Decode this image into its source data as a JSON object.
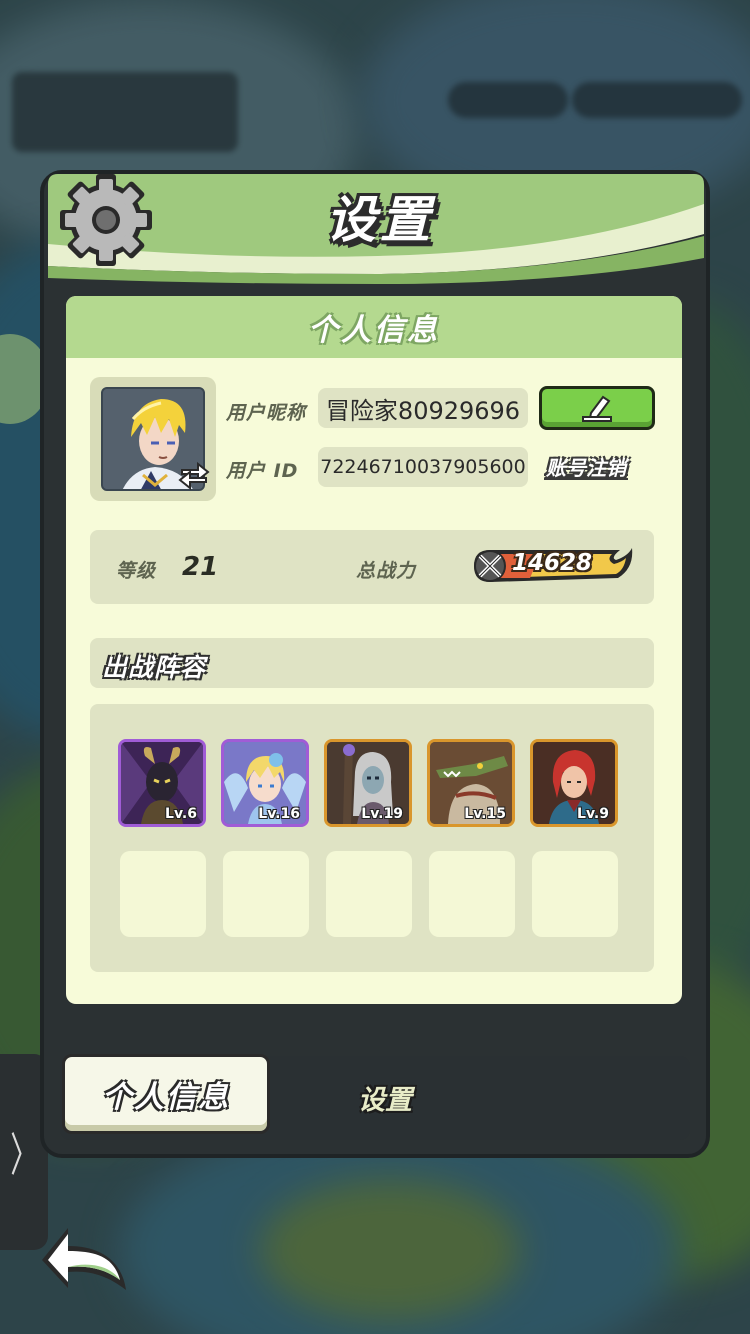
{
  "dialog": {
    "title": "设置",
    "section_title": "个人信息"
  },
  "profile": {
    "nickname_label": "用户昵称",
    "nickname": "冒险家80929696",
    "id_label": "用户 ID",
    "user_id": "72246710037905600",
    "cancel_account": "账号注销",
    "level_label": "等级",
    "level": "21",
    "power_label": "总战力",
    "power": "14628"
  },
  "lineup": {
    "title": "出战阵容",
    "heroes": [
      {
        "level": "Lv.6",
        "rarity_color": "#a05cd6"
      },
      {
        "level": "Lv.16",
        "rarity_color": "#a05cd6"
      },
      {
        "level": "Lv.19",
        "rarity_color": "#d9962c"
      },
      {
        "level": "Lv.15",
        "rarity_color": "#d9962c"
      },
      {
        "level": "Lv.9",
        "rarity_color": "#d9962c"
      }
    ],
    "empty_slots": 5
  },
  "tabs": [
    {
      "label": "个人信息",
      "active": true
    },
    {
      "label": "设置",
      "active": false
    }
  ],
  "side_tab": {
    "glyph": "〉"
  },
  "icons": [
    "gear-icon",
    "swap-icon",
    "edit-pencil-icon",
    "crossed-swords-icon",
    "back-arrow-icon"
  ],
  "colors": {
    "header_green": "#b4d98f",
    "card_bg": "#f7fbd9",
    "edit_button": "#7bcf4a",
    "power_badge": "#f1c84a"
  }
}
